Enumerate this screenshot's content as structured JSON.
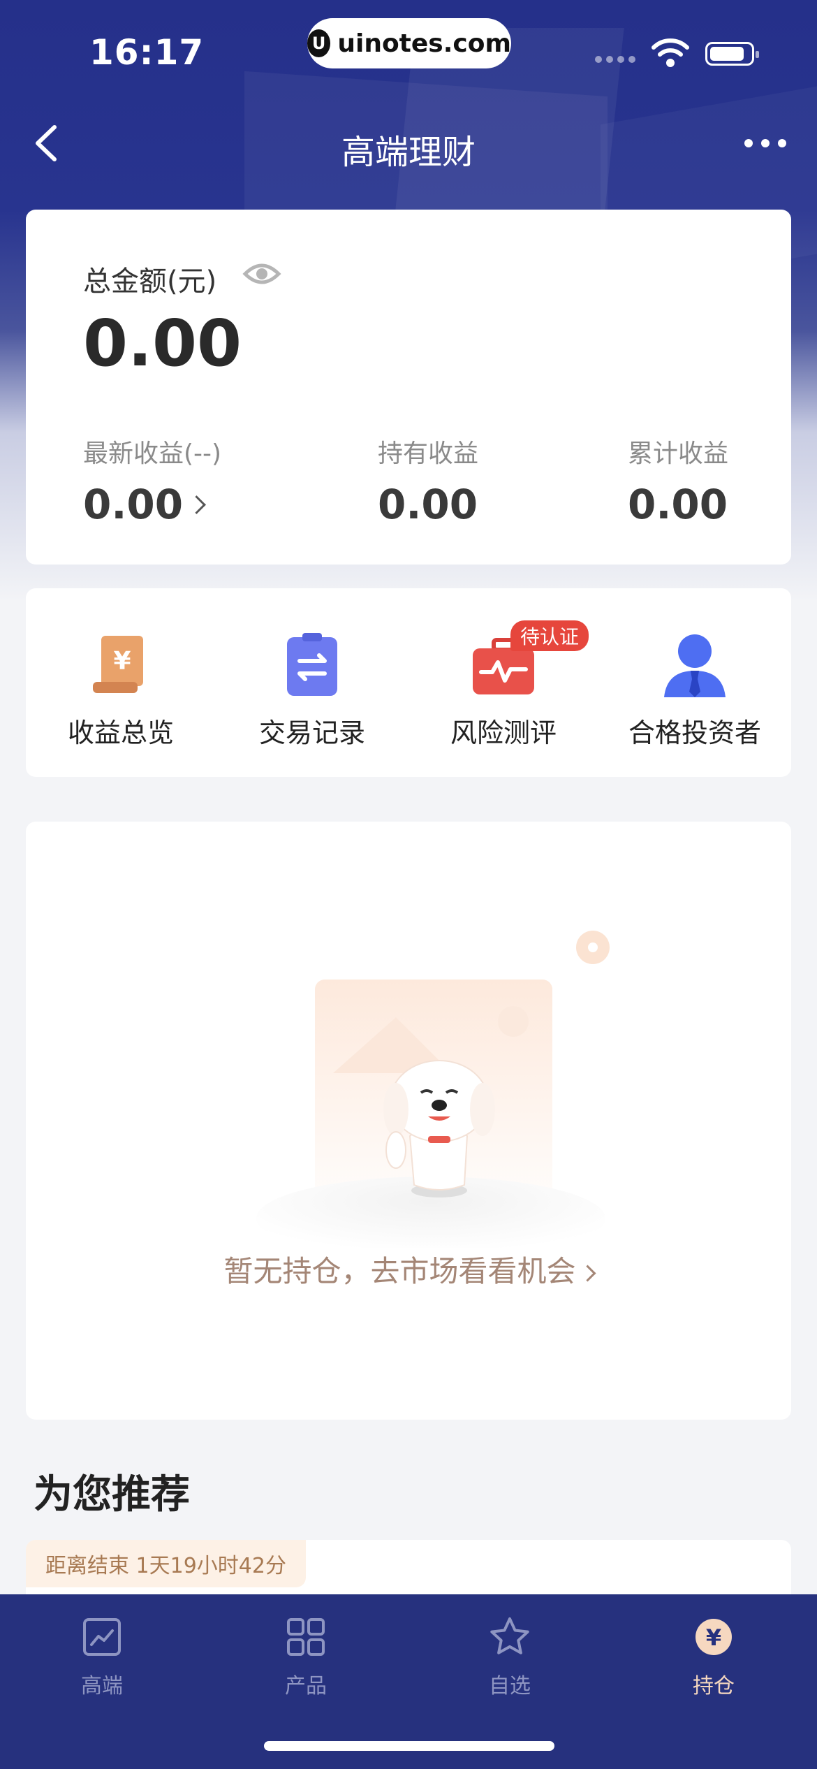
{
  "status_bar": {
    "time": "16:17",
    "url": "uinotes.com"
  },
  "nav": {
    "title": "高端理财"
  },
  "summary": {
    "total_label": "总金额(元)",
    "total_value": "0.00",
    "stats": [
      {
        "label": "最新收益(--)",
        "value": "0.00"
      },
      {
        "label": "持有收益",
        "value": "0.00"
      },
      {
        "label": "累计收益",
        "value": "0.00"
      }
    ]
  },
  "actions": [
    {
      "label": "收益总览",
      "icon": "receipt-yen-icon"
    },
    {
      "label": "交易记录",
      "icon": "clipboard-transfer-icon"
    },
    {
      "label": "风险测评",
      "icon": "briefcase-pulse-icon",
      "badge": "待认证"
    },
    {
      "label": "合格投资者",
      "icon": "investor-person-icon"
    }
  ],
  "empty": {
    "text": "暂无持仓，去市场看看机会"
  },
  "recommend": {
    "title": "为您推荐",
    "countdown": "距离结束 1天19小时42分"
  },
  "tabs": [
    {
      "label": "高端",
      "icon": "chart-trend-icon",
      "active": false
    },
    {
      "label": "产品",
      "icon": "grid-icon",
      "active": false
    },
    {
      "label": "自选",
      "icon": "star-icon",
      "active": false
    },
    {
      "label": "持仓",
      "icon": "yen-coin-icon",
      "active": true
    }
  ],
  "colors": {
    "brand": "#26317e",
    "accent": "#e6463c",
    "tab_active": "#f6d8c0"
  }
}
